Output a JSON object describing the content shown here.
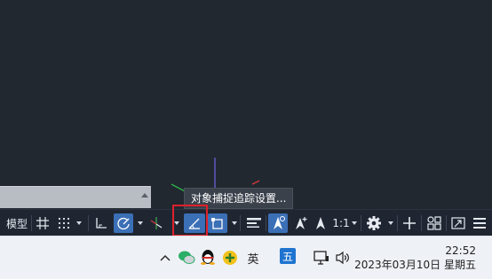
{
  "tooltip": {
    "text": "对象捕捉追踪设置..."
  },
  "statusbar": {
    "model_tab": "模型",
    "annotation_scale": "1:1"
  },
  "colors": {
    "canvas": "#212830",
    "statusbar": "#1f2632",
    "active_toggle": "#3b6fb6",
    "highlight": "#e0202a",
    "taskbar": "#eef1f6"
  },
  "icons": [
    "grid-icon",
    "snap-icon",
    "ortho-icon",
    "polar-icon",
    "isodraft-icon",
    "otrack-icon",
    "osnap-icon",
    "lineweight-icon",
    "annotation-visibility-icon",
    "autoscale-icon",
    "annotation-scale-icon",
    "workspace-gear-icon",
    "plus-icon",
    "isolate-objects-icon",
    "fullscreen-icon",
    "customize-menu-icon",
    "chevron-up-icon",
    "wechat-icon",
    "qq-icon",
    "app-plus-icon",
    "ime-mode-icon",
    "wubi-ime-icon",
    "network-icon",
    "volume-icon"
  ],
  "taskbar": {
    "ime_mode": "英",
    "wubi_label": "五",
    "time": "22:52",
    "date": "2023年03月10日 星期五"
  }
}
